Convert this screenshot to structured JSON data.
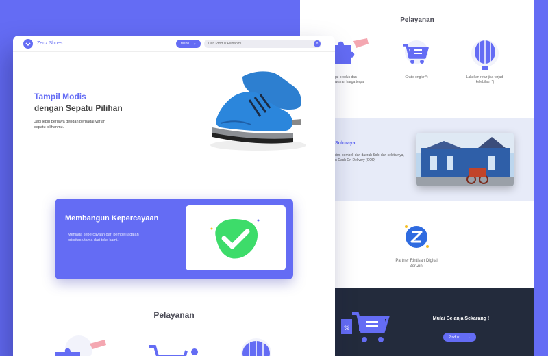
{
  "back": {
    "services_title": "Pelayanan",
    "services": [
      {
        "label": "...bagai produk dan\n...enawaran harga terpal",
        "icon": "puzzle-icon"
      },
      {
        "label": "Gratis ongkir *)",
        "icon": "cart-icon"
      },
      {
        "label": "Lakukan retur jika terjadi\nkelebihan *)",
        "icon": "hot-air-balloon-icon"
      }
    ],
    "location": {
      "title": "Soloraya",
      "text": "...rim, pembeli dari daerah Solo dan sekitarnya,\n...n Cash On Delivery (COD)",
      "photo": "solo-palace-photo"
    },
    "partner": {
      "label": "Partner Rintisan Digital\nZenZini",
      "logo": "zenzini-logo-icon"
    },
    "cta": {
      "title": "Mulai Belanja Sekarang !",
      "button": "Produk"
    }
  },
  "front": {
    "brand": "Zenz Shoes",
    "menu_label": "Menu",
    "search_placeholder": "Dari Produk Pilihanmu",
    "hero": {
      "title_accent": "Tampil Modis",
      "title_rest": "dengan Sepatu Pilihan",
      "subtitle": "Jadi lebih bergaya dengan berbagai varian\nsepatu pilihanmu.",
      "image": "blue-sneakers-photo"
    },
    "trust": {
      "title": "Membangun Kepercayaan",
      "text": "Menjaga kepercayaan dari pembeli adalah\nprioritas utama dari toko kami.",
      "icon": "check-badge-icon"
    },
    "services_title": "Pelayanan"
  },
  "colors": {
    "accent": "#646cf4",
    "dark": "#232b3c",
    "band": "#e7ebf8",
    "check": "#3ddc6a"
  }
}
